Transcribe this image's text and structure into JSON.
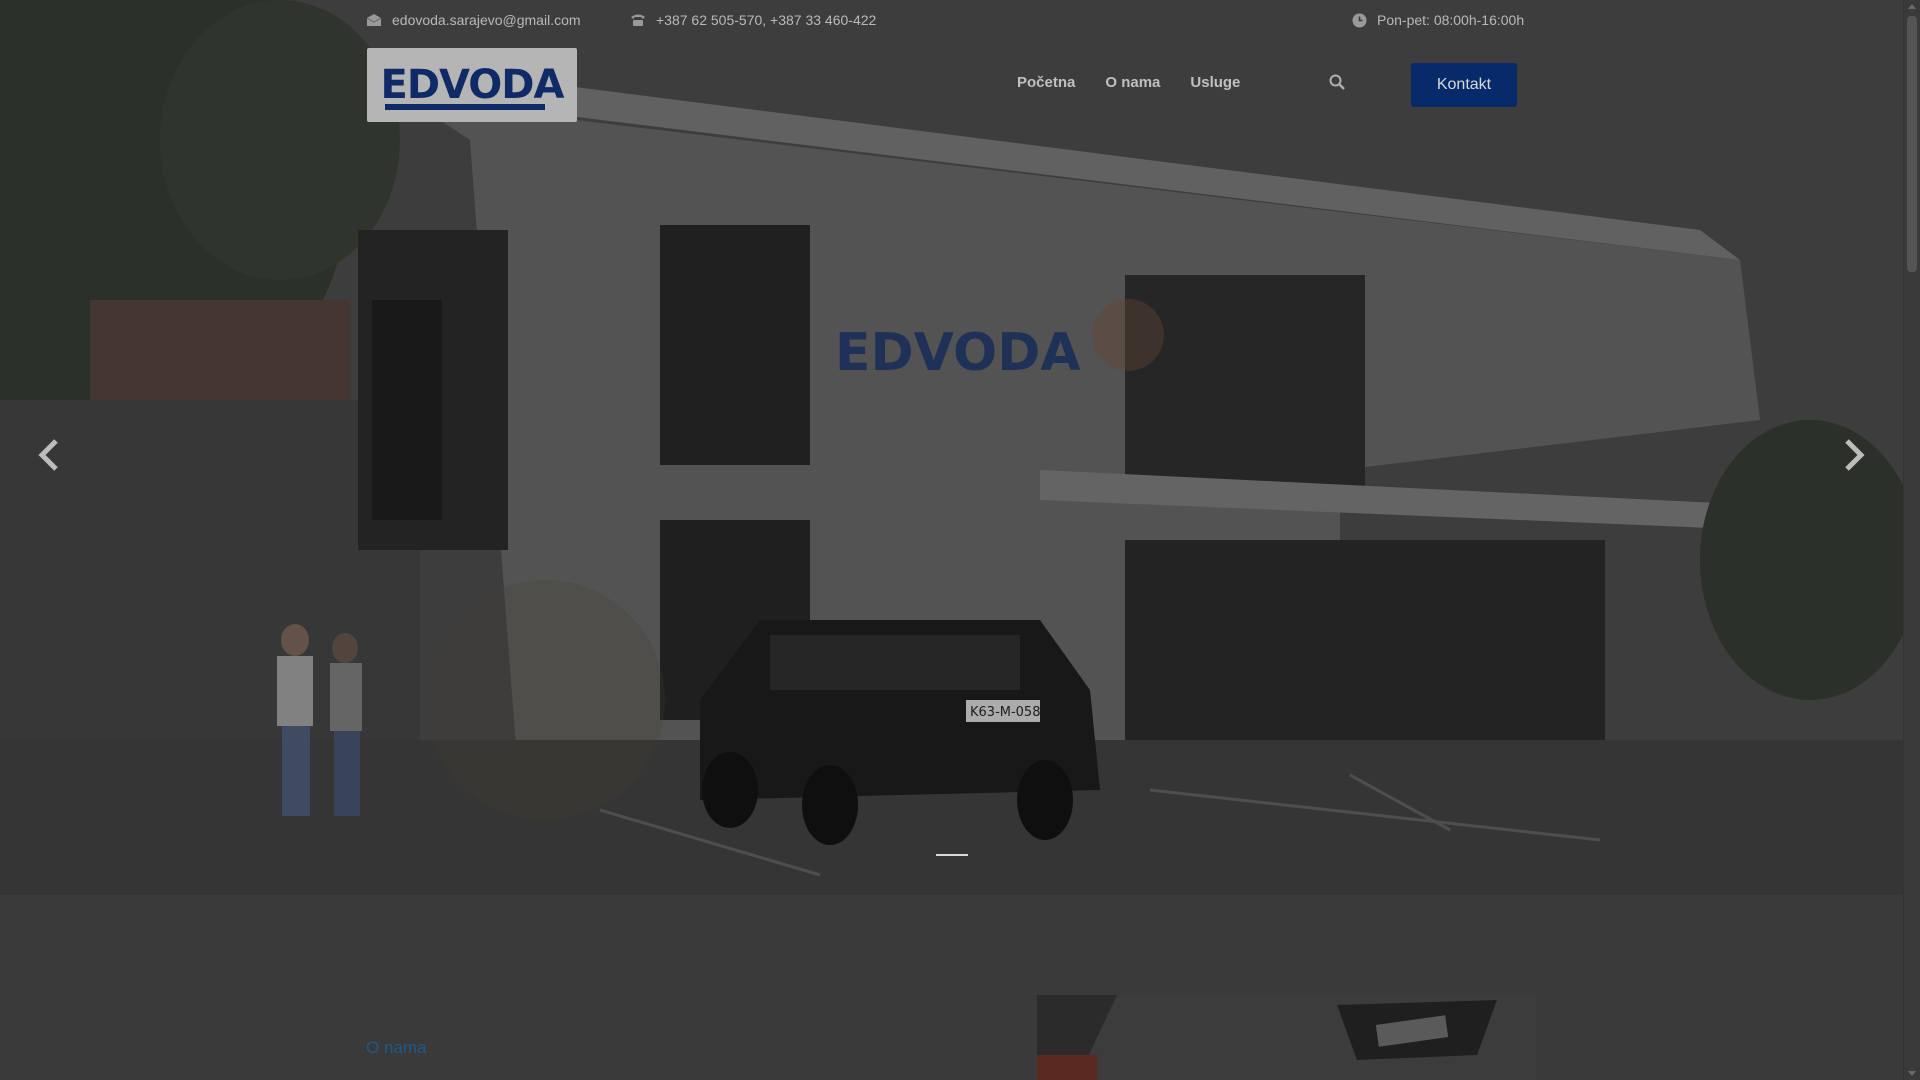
{
  "topbar": {
    "email": "edovoda.sarajevo@gmail.com",
    "phone": "+387 62 505-570, +387 33 460-422",
    "hours": "Pon-pet: 08:00h-16:00h"
  },
  "logo": {
    "text": "EDVODA"
  },
  "nav": {
    "items": [
      "Početna",
      "O nama",
      "Usluge"
    ]
  },
  "header": {
    "cta_label": "Kontakt"
  },
  "hero": {
    "sign_text": "EDVODA",
    "plate_text": "K63-M-058"
  },
  "about": {
    "label": "O nama"
  },
  "colors": {
    "brand_blue": "#062a6a",
    "accent_blue": "#1d5a8a"
  },
  "icons": [
    "envelope-icon",
    "phone-icon",
    "clock-icon",
    "search-icon",
    "chevron-left-icon",
    "chevron-right-icon"
  ]
}
